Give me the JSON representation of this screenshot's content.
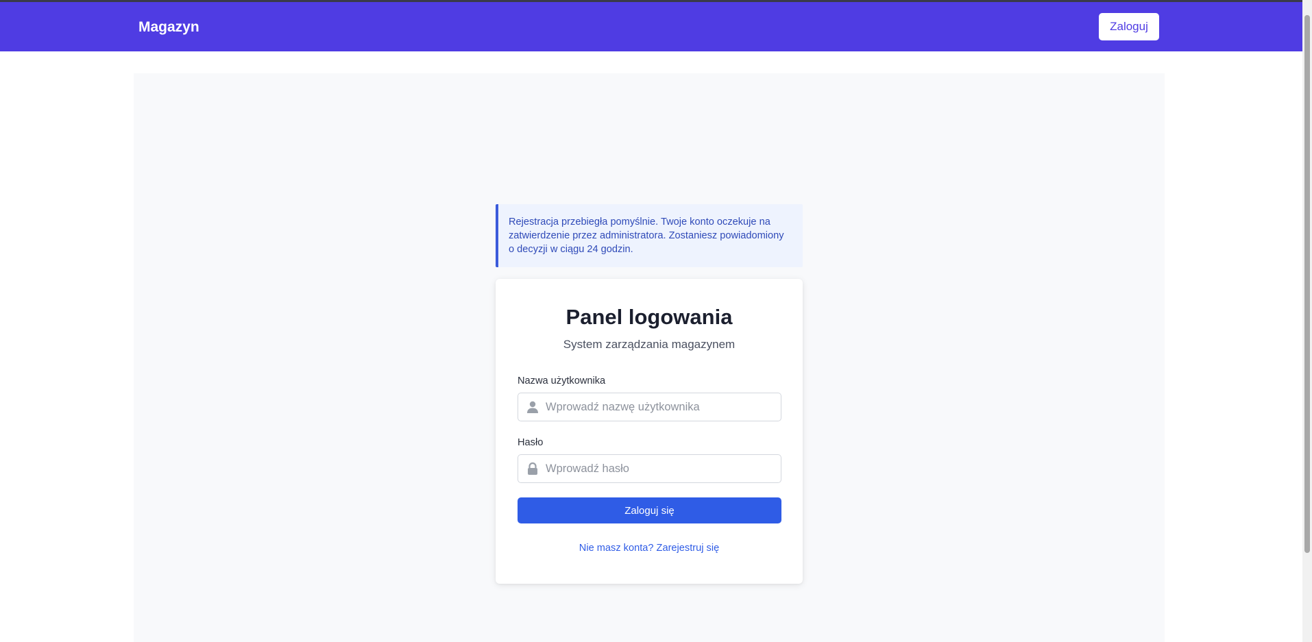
{
  "navbar": {
    "brand": "Magazyn",
    "login_button": "Zaloguj"
  },
  "alert": {
    "message": "Rejestracja przebiegła pomyślnie. Twoje konto oczekuje na zatwierdzenie przez administratora. Zostaniesz powiadomiony o decyzji w ciągu 24 godzin."
  },
  "login_card": {
    "title": "Panel logowania",
    "subtitle": "System zarządzania magazynem",
    "username": {
      "label": "Nazwa użytkownika",
      "value": "",
      "placeholder": "Wprowadź nazwę użytkownika",
      "icon": "user-icon"
    },
    "password": {
      "label": "Hasło",
      "value": "",
      "placeholder": "Wprowadź hasło",
      "icon": "lock-icon"
    },
    "submit_label": "Zaloguj się",
    "register_link": "Nie masz konta? Zarejestruj się"
  },
  "colors": {
    "navbar": "#4f3ce3",
    "primary_button": "#2f5ce6",
    "alert_border": "#3b5bdb",
    "alert_background": "#eef3fe"
  }
}
